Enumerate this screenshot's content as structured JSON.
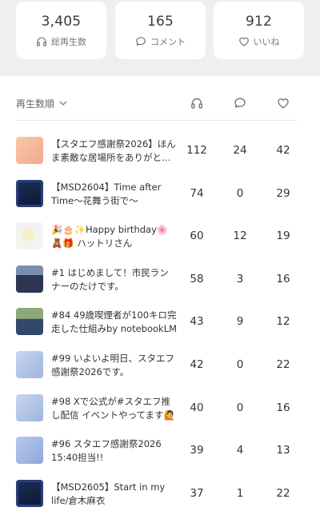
{
  "summary": {
    "plays": {
      "value": "3,405",
      "label": "総再生数",
      "icon": "headphones-icon"
    },
    "comments": {
      "value": "165",
      "label": "コメント",
      "icon": "comment-icon"
    },
    "likes": {
      "value": "912",
      "label": "いいね",
      "icon": "heart-icon"
    }
  },
  "list_header": {
    "sort_label": "再生数順",
    "columns": [
      "headphones-icon",
      "comment-icon",
      "heart-icon"
    ]
  },
  "episodes": [
    {
      "title": "【スタエフ感謝祭2026】ほんま素敵な居場所をありがとう…",
      "plays": "112",
      "comments": "24",
      "likes": "42",
      "thumb": "peach"
    },
    {
      "title": "【MSD2604】Time after Time〜花舞う街で〜",
      "plays": "74",
      "comments": "0",
      "likes": "29",
      "thumb": "dark-blue"
    },
    {
      "title": "🎉🎂✨Happy birthday🌸🧸🎁 ハットリさん",
      "plays": "60",
      "comments": "12",
      "likes": "19",
      "thumb": "white-flower"
    },
    {
      "title": "#1 はじめまして！市民ランナーのたけです。",
      "plays": "58",
      "comments": "3",
      "likes": "16",
      "thumb": "runners"
    },
    {
      "title": "#84 49歳喫煙者が100キロ完走した仕組みby notebookLM",
      "plays": "43",
      "comments": "9",
      "likes": "12",
      "thumb": "runner"
    },
    {
      "title": "#99 いよいよ明日、スタエフ感謝祭2026です。",
      "plays": "42",
      "comments": "0",
      "likes": "22",
      "thumb": "light-blue"
    },
    {
      "title": "#98 Xで公式が#スタエフ推し配信 イベントやってます🙋",
      "plays": "40",
      "comments": "0",
      "likes": "16",
      "thumb": "light-blue"
    },
    {
      "title": "#96 スタエフ感謝祭2026 15:40担当!!",
      "plays": "39",
      "comments": "4",
      "likes": "13",
      "thumb": "light-blue-2"
    },
    {
      "title": "【MSD2605】Start in my life/倉木麻衣",
      "plays": "37",
      "comments": "1",
      "likes": "22",
      "thumb": "dark-blue"
    }
  ]
}
